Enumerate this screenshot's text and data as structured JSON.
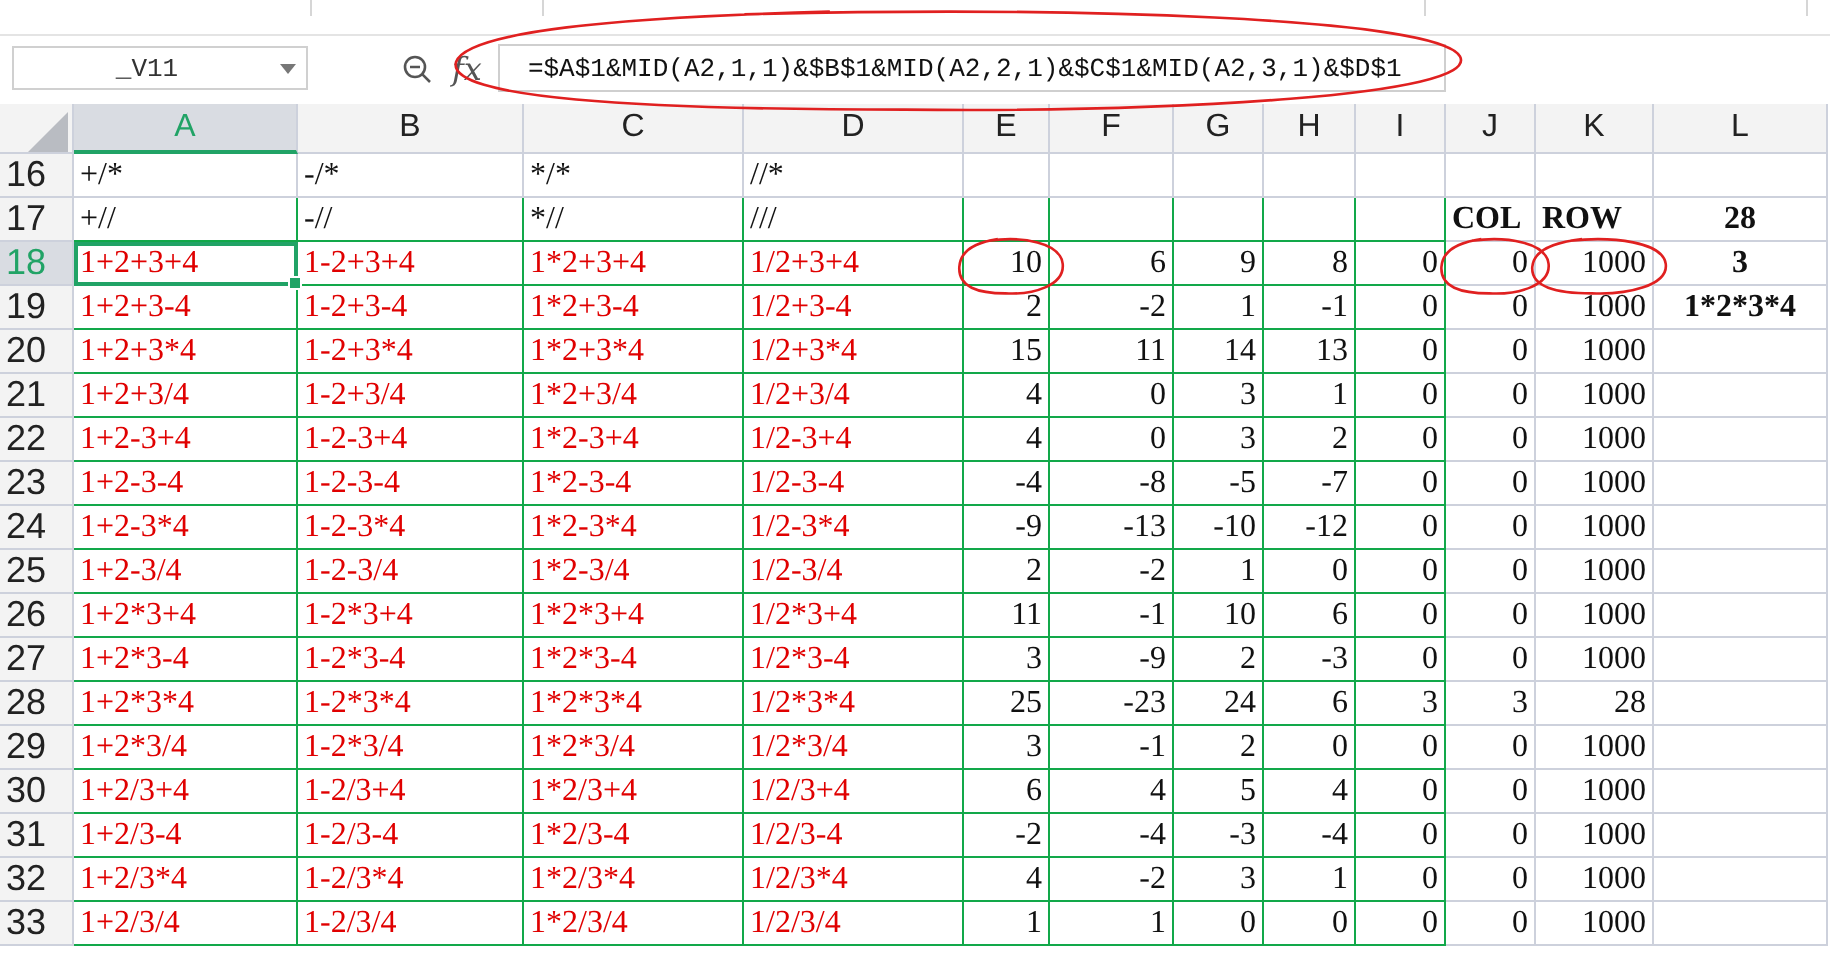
{
  "name_box": {
    "value": "_V11"
  },
  "formula_bar": {
    "fx_label": "fx",
    "formula": "=$A$1&MID(A2,1,1)&$B$1&MID(A2,2,1)&$C$1&MID(A2,3,1)&$D$1",
    "circled": true
  },
  "columns": [
    {
      "label": "A",
      "selected": true
    },
    {
      "label": "B",
      "selected": false
    },
    {
      "label": "C",
      "selected": false
    },
    {
      "label": "D",
      "selected": false
    },
    {
      "label": "E",
      "selected": false
    },
    {
      "label": "F",
      "selected": false
    },
    {
      "label": "G",
      "selected": false
    },
    {
      "label": "H",
      "selected": false
    },
    {
      "label": "I",
      "selected": false
    },
    {
      "label": "J",
      "selected": false
    },
    {
      "label": "K",
      "selected": false
    },
    {
      "label": "L",
      "selected": false
    }
  ],
  "rows": [
    {
      "number": "16",
      "kind": "pattern",
      "selected": false,
      "cells": [
        {
          "text": "+/*",
          "circled": false
        },
        {
          "text": "-/*",
          "circled": false
        },
        {
          "text": "*/*",
          "circled": false
        },
        {
          "text": "//*",
          "circled": false
        },
        {
          "circled": false
        },
        {
          "circled": false
        },
        {
          "circled": false
        },
        {
          "circled": false
        },
        {
          "circled": false
        },
        {
          "circled": false
        },
        {
          "circled": false
        },
        {
          "circled": false
        }
      ]
    },
    {
      "number": "17",
      "kind": "pattern",
      "selected": false,
      "cells": [
        {
          "text": "+//",
          "circled": false
        },
        {
          "text": "-//",
          "circled": false
        },
        {
          "text": "*//",
          "circled": false
        },
        {
          "text": "///",
          "circled": false
        },
        {
          "circled": false
        },
        {
          "circled": false
        },
        {
          "circled": false
        },
        {
          "circled": false
        },
        {
          "circled": false
        },
        {
          "text": "COL",
          "circled": false
        },
        {
          "text": "ROW",
          "circled": false
        },
        {
          "text": "28",
          "circled": false
        }
      ]
    },
    {
      "number": "18",
      "kind": "result",
      "selected": true,
      "cells": [
        {
          "text": "1+2+3+4",
          "circled": false
        },
        {
          "text": "1-2+3+4",
          "circled": false
        },
        {
          "text": "1*2+3+4",
          "circled": false
        },
        {
          "text": "1/2+3+4",
          "circled": false
        },
        {
          "text": "10",
          "circled": true
        },
        {
          "text": "6",
          "circled": false
        },
        {
          "text": "9",
          "circled": false
        },
        {
          "text": "8",
          "circled": false
        },
        {
          "text": "0",
          "circled": false
        },
        {
          "text": "0",
          "circled": true
        },
        {
          "text": "1000",
          "circled": true
        },
        {
          "text": "3",
          "circled": false
        }
      ]
    },
    {
      "number": "19",
      "kind": "result",
      "selected": false,
      "cells": [
        {
          "text": "1+2+3-4",
          "circled": false
        },
        {
          "text": "1-2+3-4",
          "circled": false
        },
        {
          "text": "1*2+3-4",
          "circled": false
        },
        {
          "text": "1/2+3-4",
          "circled": false
        },
        {
          "text": "2",
          "circled": false
        },
        {
          "text": "-2",
          "circled": false
        },
        {
          "text": "1",
          "circled": false
        },
        {
          "text": "-1",
          "circled": false
        },
        {
          "text": "0",
          "circled": false
        },
        {
          "text": "0",
          "circled": false
        },
        {
          "text": "1000",
          "circled": false
        },
        {
          "text": "1*2*3*4",
          "circled": false
        }
      ]
    },
    {
      "number": "20",
      "kind": "result",
      "selected": false,
      "cells": [
        {
          "text": "1+2+3*4",
          "circled": false
        },
        {
          "text": "1-2+3*4",
          "circled": false
        },
        {
          "text": "1*2+3*4",
          "circled": false
        },
        {
          "text": "1/2+3*4",
          "circled": false
        },
        {
          "text": "15",
          "circled": false
        },
        {
          "text": "11",
          "circled": false
        },
        {
          "text": "14",
          "circled": false
        },
        {
          "text": "13",
          "circled": false
        },
        {
          "text": "0",
          "circled": false
        },
        {
          "text": "0",
          "circled": false
        },
        {
          "text": "1000",
          "circled": false
        },
        {
          "circled": false
        }
      ]
    },
    {
      "number": "21",
      "kind": "result",
      "selected": false,
      "cells": [
        {
          "text": "1+2+3/4",
          "circled": false
        },
        {
          "text": "1-2+3/4",
          "circled": false
        },
        {
          "text": "1*2+3/4",
          "circled": false
        },
        {
          "text": "1/2+3/4",
          "circled": false
        },
        {
          "text": "4",
          "circled": false
        },
        {
          "text": "0",
          "circled": false
        },
        {
          "text": "3",
          "circled": false
        },
        {
          "text": "1",
          "circled": false
        },
        {
          "text": "0",
          "circled": false
        },
        {
          "text": "0",
          "circled": false
        },
        {
          "text": "1000",
          "circled": false
        },
        {
          "circled": false
        }
      ]
    },
    {
      "number": "22",
      "kind": "result",
      "selected": false,
      "cells": [
        {
          "text": "1+2-3+4",
          "circled": false
        },
        {
          "text": "1-2-3+4",
          "circled": false
        },
        {
          "text": "1*2-3+4",
          "circled": false
        },
        {
          "text": "1/2-3+4",
          "circled": false
        },
        {
          "text": "4",
          "circled": false
        },
        {
          "text": "0",
          "circled": false
        },
        {
          "text": "3",
          "circled": false
        },
        {
          "text": "2",
          "circled": false
        },
        {
          "text": "0",
          "circled": false
        },
        {
          "text": "0",
          "circled": false
        },
        {
          "text": "1000",
          "circled": false
        },
        {
          "circled": false
        }
      ]
    },
    {
      "number": "23",
      "kind": "result",
      "selected": false,
      "cells": [
        {
          "text": "1+2-3-4",
          "circled": false
        },
        {
          "text": "1-2-3-4",
          "circled": false
        },
        {
          "text": "1*2-3-4",
          "circled": false
        },
        {
          "text": "1/2-3-4",
          "circled": false
        },
        {
          "text": "-4",
          "circled": false
        },
        {
          "text": "-8",
          "circled": false
        },
        {
          "text": "-5",
          "circled": false
        },
        {
          "text": "-7",
          "circled": false
        },
        {
          "text": "0",
          "circled": false
        },
        {
          "text": "0",
          "circled": false
        },
        {
          "text": "1000",
          "circled": false
        },
        {
          "circled": false
        }
      ]
    },
    {
      "number": "24",
      "kind": "result",
      "selected": false,
      "cells": [
        {
          "text": "1+2-3*4",
          "circled": false
        },
        {
          "text": "1-2-3*4",
          "circled": false
        },
        {
          "text": "1*2-3*4",
          "circled": false
        },
        {
          "text": "1/2-3*4",
          "circled": false
        },
        {
          "text": "-9",
          "circled": false
        },
        {
          "text": "-13",
          "circled": false
        },
        {
          "text": "-10",
          "circled": false
        },
        {
          "text": "-12",
          "circled": false
        },
        {
          "text": "0",
          "circled": false
        },
        {
          "text": "0",
          "circled": false
        },
        {
          "text": "1000",
          "circled": false
        },
        {
          "circled": false
        }
      ]
    },
    {
      "number": "25",
      "kind": "result",
      "selected": false,
      "cells": [
        {
          "text": "1+2-3/4",
          "circled": false
        },
        {
          "text": "1-2-3/4",
          "circled": false
        },
        {
          "text": "1*2-3/4",
          "circled": false
        },
        {
          "text": "1/2-3/4",
          "circled": false
        },
        {
          "text": "2",
          "circled": false
        },
        {
          "text": "-2",
          "circled": false
        },
        {
          "text": "1",
          "circled": false
        },
        {
          "text": "0",
          "circled": false
        },
        {
          "text": "0",
          "circled": false
        },
        {
          "text": "0",
          "circled": false
        },
        {
          "text": "1000",
          "circled": false
        },
        {
          "circled": false
        }
      ]
    },
    {
      "number": "26",
      "kind": "result",
      "selected": false,
      "cells": [
        {
          "text": "1+2*3+4",
          "circled": false
        },
        {
          "text": "1-2*3+4",
          "circled": false
        },
        {
          "text": "1*2*3+4",
          "circled": false
        },
        {
          "text": "1/2*3+4",
          "circled": false
        },
        {
          "text": "11",
          "circled": false
        },
        {
          "text": "-1",
          "circled": false
        },
        {
          "text": "10",
          "circled": false
        },
        {
          "text": "6",
          "circled": false
        },
        {
          "text": "0",
          "circled": false
        },
        {
          "text": "0",
          "circled": false
        },
        {
          "text": "1000",
          "circled": false
        },
        {
          "circled": false
        }
      ]
    },
    {
      "number": "27",
      "kind": "result",
      "selected": false,
      "cells": [
        {
          "text": "1+2*3-4",
          "circled": false
        },
        {
          "text": "1-2*3-4",
          "circled": false
        },
        {
          "text": "1*2*3-4",
          "circled": false
        },
        {
          "text": "1/2*3-4",
          "circled": false
        },
        {
          "text": "3",
          "circled": false
        },
        {
          "text": "-9",
          "circled": false
        },
        {
          "text": "2",
          "circled": false
        },
        {
          "text": "-3",
          "circled": false
        },
        {
          "text": "0",
          "circled": false
        },
        {
          "text": "0",
          "circled": false
        },
        {
          "text": "1000",
          "circled": false
        },
        {
          "circled": false
        }
      ]
    },
    {
      "number": "28",
      "kind": "result",
      "selected": false,
      "cells": [
        {
          "text": "1+2*3*4",
          "circled": false
        },
        {
          "text": "1-2*3*4",
          "circled": false
        },
        {
          "text": "1*2*3*4",
          "circled": false
        },
        {
          "text": "1/2*3*4",
          "circled": false
        },
        {
          "text": "25",
          "circled": false
        },
        {
          "text": "-23",
          "circled": false
        },
        {
          "text": "24",
          "circled": false
        },
        {
          "text": "6",
          "circled": false
        },
        {
          "text": "3",
          "circled": false
        },
        {
          "text": "3",
          "circled": false
        },
        {
          "text": "28",
          "circled": false
        },
        {
          "circled": false
        }
      ]
    },
    {
      "number": "29",
      "kind": "result",
      "selected": false,
      "cells": [
        {
          "text": "1+2*3/4",
          "circled": false
        },
        {
          "text": "1-2*3/4",
          "circled": false
        },
        {
          "text": "1*2*3/4",
          "circled": false
        },
        {
          "text": "1/2*3/4",
          "circled": false
        },
        {
          "text": "3",
          "circled": false
        },
        {
          "text": "-1",
          "circled": false
        },
        {
          "text": "2",
          "circled": false
        },
        {
          "text": "0",
          "circled": false
        },
        {
          "text": "0",
          "circled": false
        },
        {
          "text": "0",
          "circled": false
        },
        {
          "text": "1000",
          "circled": false
        },
        {
          "circled": false
        }
      ]
    },
    {
      "number": "30",
      "kind": "result",
      "selected": false,
      "cells": [
        {
          "text": "1+2/3+4",
          "circled": false
        },
        {
          "text": "1-2/3+4",
          "circled": false
        },
        {
          "text": "1*2/3+4",
          "circled": false
        },
        {
          "text": "1/2/3+4",
          "circled": false
        },
        {
          "text": "6",
          "circled": false
        },
        {
          "text": "4",
          "circled": false
        },
        {
          "text": "5",
          "circled": false
        },
        {
          "text": "4",
          "circled": false
        },
        {
          "text": "0",
          "circled": false
        },
        {
          "text": "0",
          "circled": false
        },
        {
          "text": "1000",
          "circled": false
        },
        {
          "circled": false
        }
      ]
    },
    {
      "number": "31",
      "kind": "result",
      "selected": false,
      "cells": [
        {
          "text": "1+2/3-4",
          "circled": false
        },
        {
          "text": "1-2/3-4",
          "circled": false
        },
        {
          "text": "1*2/3-4",
          "circled": false
        },
        {
          "text": "1/2/3-4",
          "circled": false
        },
        {
          "text": "-2",
          "circled": false
        },
        {
          "text": "-4",
          "circled": false
        },
        {
          "text": "-3",
          "circled": false
        },
        {
          "text": "-4",
          "circled": false
        },
        {
          "text": "0",
          "circled": false
        },
        {
          "text": "0",
          "circled": false
        },
        {
          "text": "1000",
          "circled": false
        },
        {
          "circled": false
        }
      ]
    },
    {
      "number": "32",
      "kind": "result",
      "selected": false,
      "cells": [
        {
          "text": "1+2/3*4",
          "circled": false
        },
        {
          "text": "1-2/3*4",
          "circled": false
        },
        {
          "text": "1*2/3*4",
          "circled": false
        },
        {
          "text": "1/2/3*4",
          "circled": false
        },
        {
          "text": "4",
          "circled": false
        },
        {
          "text": "-2",
          "circled": false
        },
        {
          "text": "3",
          "circled": false
        },
        {
          "text": "1",
          "circled": false
        },
        {
          "text": "0",
          "circled": false
        },
        {
          "text": "0",
          "circled": false
        },
        {
          "text": "1000",
          "circled": false
        },
        {
          "circled": false
        }
      ]
    },
    {
      "number": "33",
      "kind": "result",
      "selected": false,
      "cells": [
        {
          "text": "1+2/3/4",
          "circled": false
        },
        {
          "text": "1-2/3/4",
          "circled": false
        },
        {
          "text": "1*2/3/4",
          "circled": false
        },
        {
          "text": "1/2/3/4",
          "circled": false
        },
        {
          "text": "1",
          "circled": false
        },
        {
          "text": "1",
          "circled": false
        },
        {
          "text": "0",
          "circled": false
        },
        {
          "text": "0",
          "circled": false
        },
        {
          "text": "0",
          "circled": false
        },
        {
          "text": "0",
          "circled": false
        },
        {
          "text": "1000",
          "circled": false
        },
        {
          "circled": false
        }
      ]
    }
  ]
}
